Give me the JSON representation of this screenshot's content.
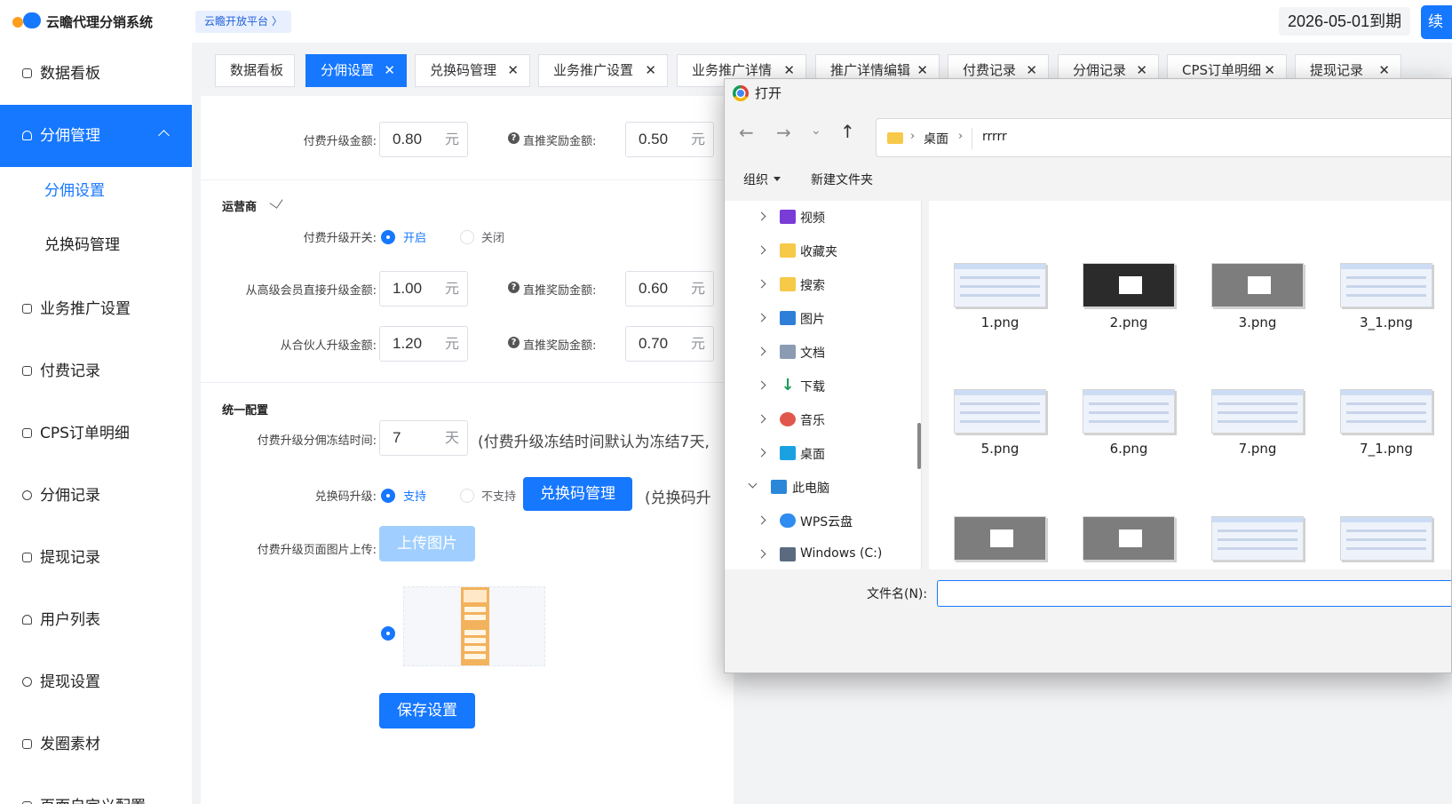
{
  "header": {
    "app_title": "云瞻代理分销系统",
    "platform_link": "云瞻开放平台 〉",
    "expire_text": "2026-05-01到期",
    "renew_label": "续"
  },
  "sidebar": {
    "items": [
      {
        "label": "数据看板"
      },
      {
        "label": "分佣管理"
      },
      {
        "label": "业务推广设置"
      },
      {
        "label": "付费记录"
      },
      {
        "label": "CPS订单明细"
      },
      {
        "label": "分佣记录"
      },
      {
        "label": "提现记录"
      },
      {
        "label": "用户列表"
      },
      {
        "label": "提现设置"
      },
      {
        "label": "发圈素材"
      },
      {
        "label": "页面自定义配置"
      }
    ],
    "sub_items": [
      {
        "label": "分佣设置"
      },
      {
        "label": "兑换码管理"
      }
    ]
  },
  "tabs": [
    {
      "label": "数据看板"
    },
    {
      "label": "分佣设置"
    },
    {
      "label": "兑换码管理"
    },
    {
      "label": "业务推广设置"
    },
    {
      "label": "业务推广详情"
    },
    {
      "label": "推广详情编辑"
    },
    {
      "label": "付费记录"
    },
    {
      "label": "分佣记录"
    },
    {
      "label": "CPS订单明细"
    },
    {
      "label": "提现记录"
    }
  ],
  "form": {
    "top_row": {
      "label": "付费升级金额:",
      "value": "0.80",
      "unit": "元",
      "bonus_label": "直推奖励金额:",
      "bonus_value": "0.50",
      "bonus_unit": "元"
    },
    "operator": {
      "title": "运营商",
      "switch_label": "付费升级开关:",
      "opt_on": "开启",
      "opt_off": "关闭",
      "row1": {
        "label": "从高级会员直接升级金额:",
        "value": "1.00",
        "unit": "元",
        "bonus_label": "直推奖励金额:",
        "bonus_value": "0.60",
        "bonus_unit": "元"
      },
      "row2": {
        "label": "从合伙人升级金额:",
        "value": "1.20",
        "unit": "元",
        "bonus_label": "直推奖励金额:",
        "bonus_value": "0.70",
        "bonus_unit": "元"
      }
    },
    "unified": {
      "title": "统一配置",
      "freeze_label": "付费升级分佣冻结时间:",
      "freeze_value": "7",
      "freeze_unit": "天",
      "freeze_note": "(付费升级冻结时间默认为冻结7天,",
      "redeem_label": "兑换码升级:",
      "redeem_on": "支持",
      "redeem_off": "不支持",
      "redeem_btn": "兑换码管理",
      "redeem_note": "(兑换码升",
      "upload_label": "付费升级页面图片上传:",
      "upload_btn": "上传图片",
      "save_btn": "保存设置"
    }
  },
  "dialog": {
    "title": "打开",
    "path": [
      "桌面",
      "rrrrr"
    ],
    "toolbar": {
      "organize": "组织",
      "new_folder": "新建文件夹"
    },
    "tree": [
      {
        "label": "视频",
        "color": "#7a3cd6"
      },
      {
        "label": "收藏夹",
        "color": "#f7c948"
      },
      {
        "label": "搜索",
        "color": "#f7c948"
      },
      {
        "label": "图片",
        "color": "#2f7fd8"
      },
      {
        "label": "文档",
        "color": "#8b9bb4"
      },
      {
        "label": "下载",
        "color": "#1a9e5a"
      },
      {
        "label": "音乐",
        "color": "#e2574c"
      },
      {
        "label": "桌面",
        "color": "#1ba1e2"
      },
      {
        "label": "此电脑",
        "color": "#2b88d8"
      },
      {
        "label": "WPS云盘",
        "color": "#2f8cf0"
      },
      {
        "label": "Windows (C:)",
        "color": "#5a6b80"
      }
    ],
    "files": [
      {
        "name": "1.png",
        "style": "light"
      },
      {
        "name": "2.png",
        "style": "dark"
      },
      {
        "name": "3.png",
        "style": "gray"
      },
      {
        "name": "3_1.png",
        "style": "light"
      },
      {
        "name": "5.png",
        "style": "light"
      },
      {
        "name": "6.png",
        "style": "light"
      },
      {
        "name": "7.png",
        "style": "light"
      },
      {
        "name": "7_1.png",
        "style": "light"
      },
      {
        "name": "",
        "style": "gray"
      },
      {
        "name": "",
        "style": "gray"
      },
      {
        "name": "",
        "style": "light"
      },
      {
        "name": "",
        "style": "light"
      }
    ],
    "filename_label": "文件名(N):",
    "filename_value": ""
  },
  "colors": {
    "accent": "#1677ff",
    "upload_btn": "#a0cfff"
  }
}
